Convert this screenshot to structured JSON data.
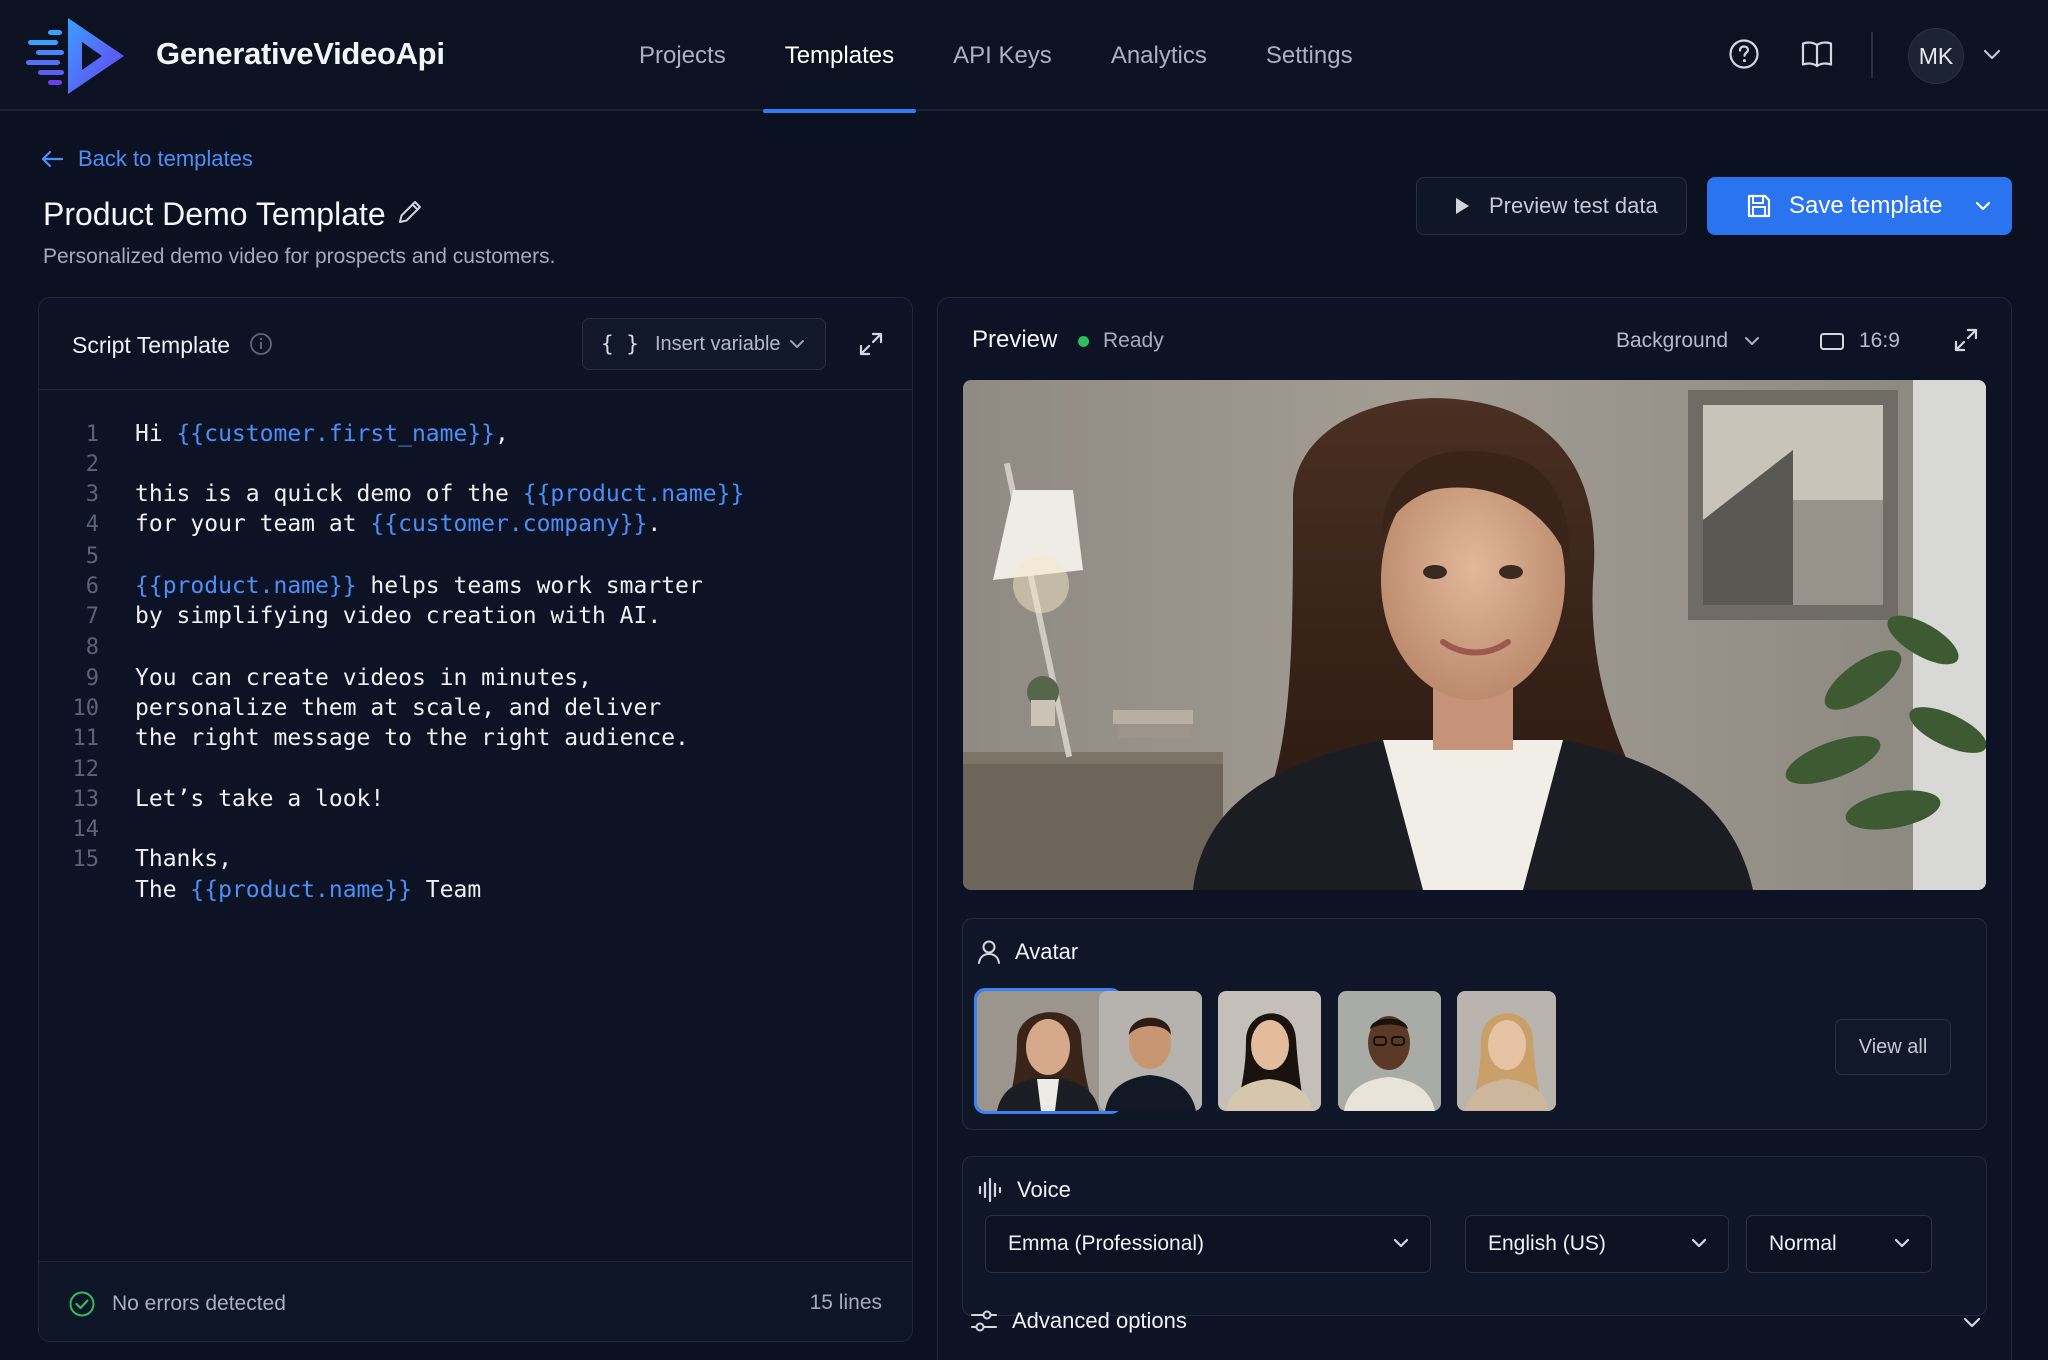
{
  "brand": {
    "name": "GenerativeVideoApi"
  },
  "nav": {
    "items": [
      {
        "label": "Projects",
        "active": false
      },
      {
        "label": "Templates",
        "active": true
      },
      {
        "label": "API Keys",
        "active": false
      },
      {
        "label": "Analytics",
        "active": false
      },
      {
        "label": "Settings",
        "active": false
      }
    ]
  },
  "user": {
    "initials": "MK"
  },
  "header": {
    "back_label": "Back to templates",
    "title": "Product Demo Template",
    "subtitle": "Personalized demo video for prospects and customers.",
    "preview_label": "Preview test data",
    "save_label": "Save template"
  },
  "script": {
    "title": "Script Template",
    "insert_label": "Insert variable",
    "insert_braces": "{ }",
    "lines": [
      {
        "n": "1",
        "text": "Hi {{customer.first_name}},"
      },
      {
        "n": "2",
        "text": ""
      },
      {
        "n": "3",
        "text": "this is a quick demo of the {{product.name}}"
      },
      {
        "n": "4",
        "text": "for your team at {{customer.company}}."
      },
      {
        "n": "5",
        "text": ""
      },
      {
        "n": "6",
        "text": "{{product.name}} helps teams work smarter"
      },
      {
        "n": "7",
        "text": "by simplifying video creation with AI."
      },
      {
        "n": "8",
        "text": ""
      },
      {
        "n": "9",
        "text": "You can create videos in minutes,"
      },
      {
        "n": "10",
        "text": "personalize them at scale, and deliver"
      },
      {
        "n": "11",
        "text": "the right message to the right audience."
      },
      {
        "n": "12",
        "text": ""
      },
      {
        "n": "13",
        "text": "Let’s take a look!"
      },
      {
        "n": "14",
        "text": ""
      },
      {
        "n": "15",
        "text": "Thanks,"
      },
      {
        "n": "",
        "text": "The {{product.name}} Team"
      }
    ],
    "status": "No errors detected",
    "line_count": "15 lines"
  },
  "preview": {
    "title": "Preview",
    "status": "Ready",
    "background_label": "Background",
    "ratio": "16:9"
  },
  "avatar": {
    "title": "Avatar",
    "view_all": "View all",
    "selected_index": 0,
    "count": 5
  },
  "voice": {
    "title": "Voice",
    "name": "Emma (Professional)",
    "language": "English (US)",
    "speed": "Normal"
  },
  "advanced": {
    "label": "Advanced options"
  },
  "colors": {
    "accent": "#2b74f0",
    "variable": "#4b8ff9",
    "ready": "#2fbf5a",
    "background": "#0b1120"
  },
  "icons": [
    "logo-play-icon",
    "help-icon",
    "book-icon",
    "chevron-down-icon",
    "arrow-left-icon",
    "pencil-icon",
    "play-icon",
    "save-icon",
    "info-icon",
    "braces-icon",
    "expand-icon",
    "aspect-ratio-icon",
    "user-icon",
    "waveform-icon",
    "sliders-icon",
    "check-circle-icon"
  ]
}
